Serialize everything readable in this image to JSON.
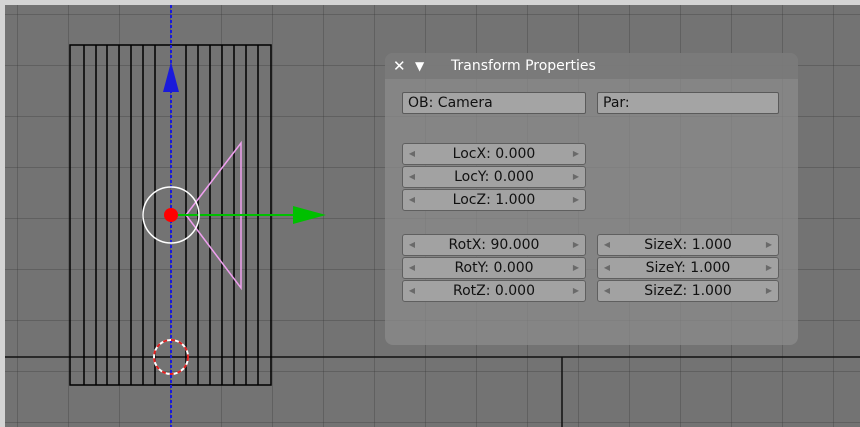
{
  "window": {
    "background": "#737373"
  },
  "panel": {
    "title": "Transform Properties",
    "close_icon": "close-icon",
    "collapse_icon": "triangle-down-icon",
    "object_field": "OB: Camera",
    "parent_field": "Par:",
    "location": [
      {
        "label": "LocX: 0.000"
      },
      {
        "label": "LocY: 0.000"
      },
      {
        "label": "LocZ: 1.000"
      }
    ],
    "rotation": [
      {
        "label": "RotX: 90.000"
      },
      {
        "label": "RotY: 0.000"
      },
      {
        "label": "RotZ: 0.000"
      }
    ],
    "size": [
      {
        "label": "SizeX: 1.000"
      },
      {
        "label": "SizeY: 1.000"
      },
      {
        "label": "SizeZ: 1.000"
      }
    ]
  },
  "colors": {
    "x_axis": "#00c000",
    "z_axis": "#1a1adb",
    "camera_frustum": "#f0a0f0",
    "origin": "#ff0000"
  }
}
